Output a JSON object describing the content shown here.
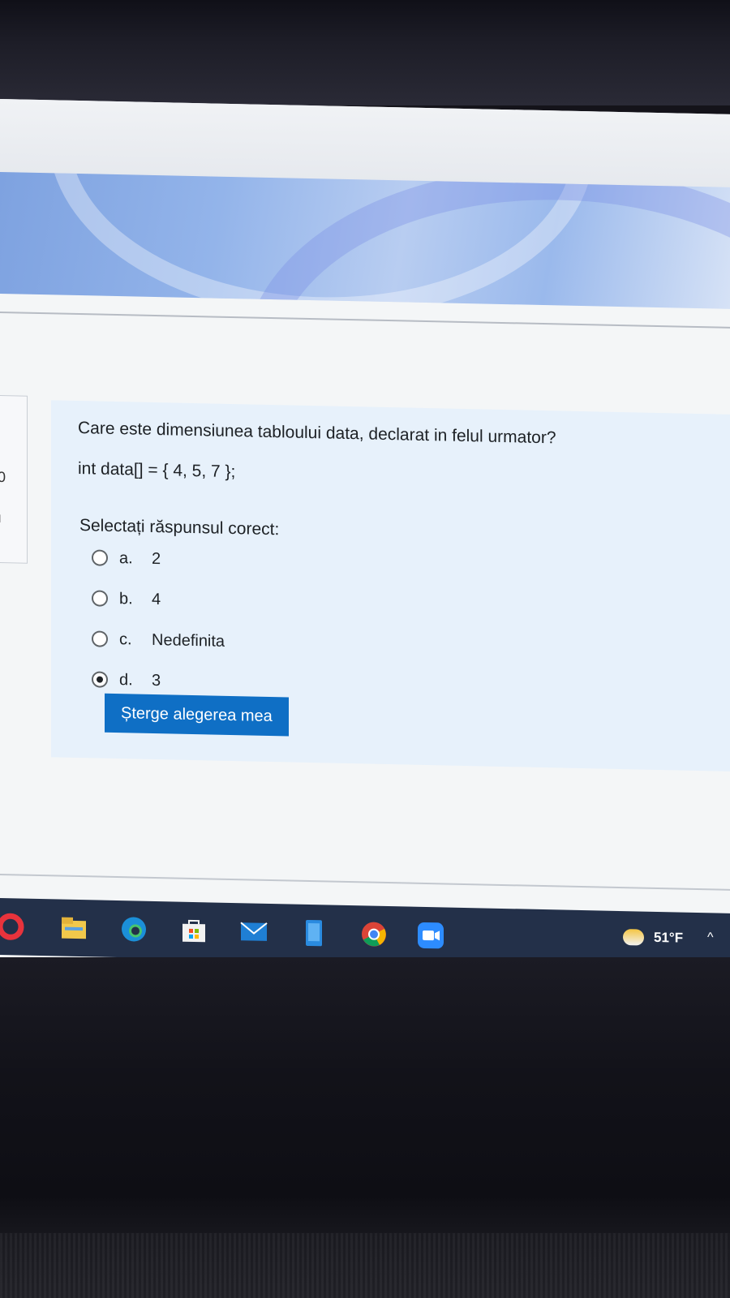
{
  "question": {
    "text": "Care este dimensiunea tabloului data, declarat in felul urmator?",
    "code": "int data[] = { 4, 5, 7 };",
    "prompt": "Selectați răspunsul corect:",
    "options": [
      {
        "letter": "a.",
        "value": "2",
        "selected": false
      },
      {
        "letter": "b.",
        "value": "4",
        "selected": false
      },
      {
        "letter": "c.",
        "value": "Nedefinita",
        "selected": false
      },
      {
        "letter": "d.",
        "value": "3",
        "selected": true
      }
    ],
    "clear_label": "Șterge alegerea mea"
  },
  "side_panel": {
    "glyph_top": "0",
    "glyph_bottom": "ı"
  },
  "taskbar": {
    "icons": [
      "opera-icon",
      "file-explorer-icon",
      "edge-icon",
      "store-icon",
      "mail-icon",
      "phone-link-icon",
      "chrome-icon",
      "zoom-icon"
    ],
    "temperature": "51°F",
    "tray_chevron": "^"
  },
  "colors": {
    "accent": "#0f6fc5",
    "question_bg": "#e7f1fb",
    "taskbar": "#233049"
  }
}
